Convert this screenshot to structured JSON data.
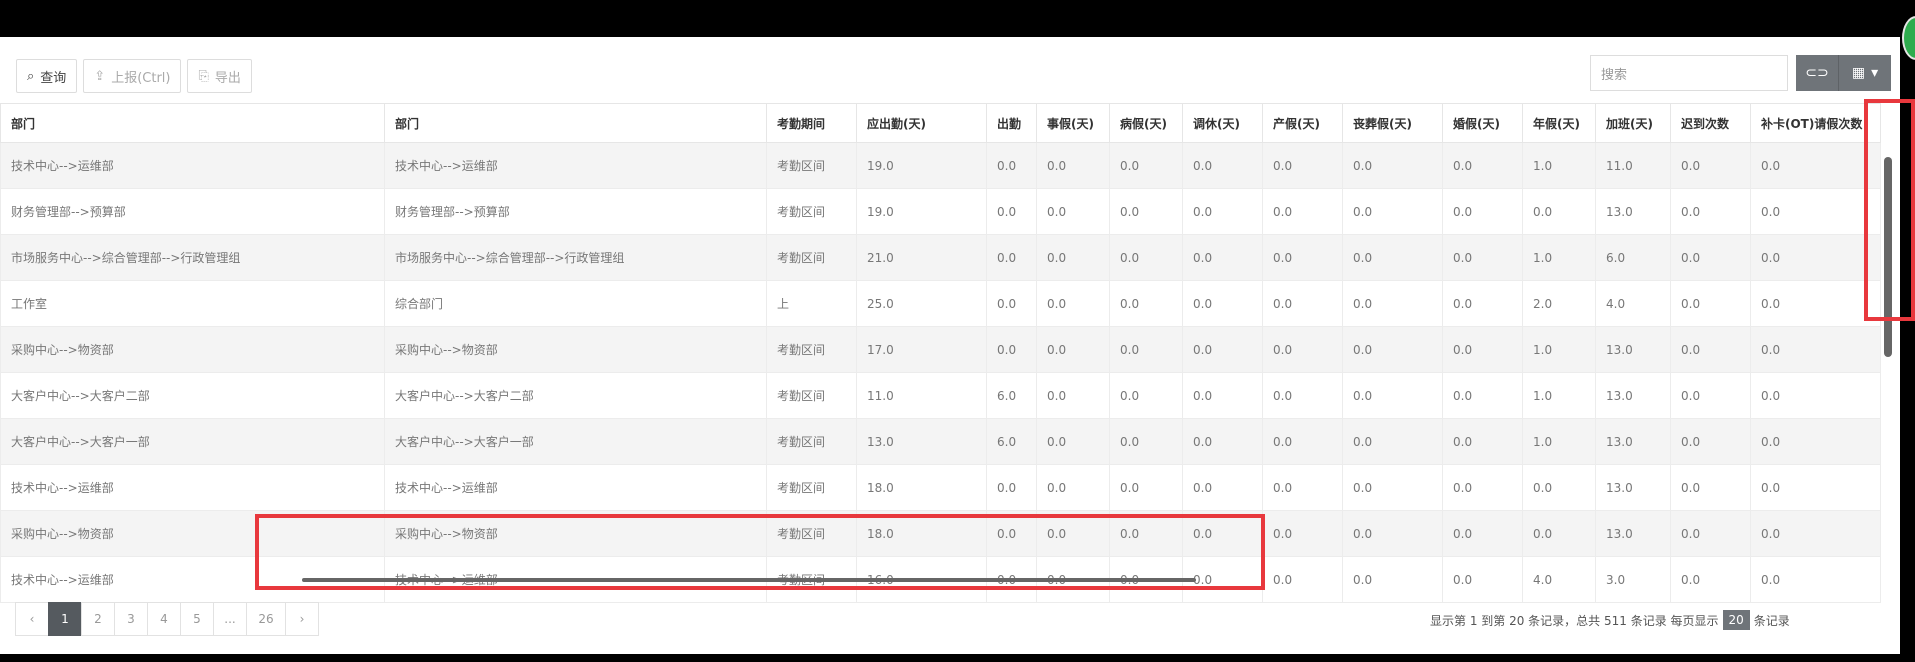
{
  "toolbar": {
    "buttons": [
      {
        "label": "查询",
        "icon": "search-icon"
      },
      {
        "label": "上报(Ctrl)",
        "icon": "upload-icon"
      },
      {
        "label": "导出",
        "icon": "export-icon"
      }
    ]
  },
  "search": {
    "placeholder": "搜索"
  },
  "table": {
    "headers": [
      "部门",
      "部门",
      "考勤期间",
      "应出勤(天)",
      "出勤",
      "事假(天)",
      "病假(天)",
      "调休(天)",
      "产假(天)",
      "丧葬假(天)",
      "婚假(天)",
      "年假(天)",
      "加班(天)",
      "迟到次数",
      "补卡(OT)请假次数"
    ],
    "rows": [
      [
        "技术中心-->运维部",
        "技术中心-->运维部",
        "考勤区间",
        "19.0",
        "0.0",
        "0.0",
        "0.0",
        "0.0",
        "0.0",
        "0.0",
        "0.0",
        "1.0",
        "11.0",
        "0.0",
        "0.0"
      ],
      [
        "财务管理部-->预算部",
        "财务管理部-->预算部",
        "考勤区间",
        "19.0",
        "0.0",
        "0.0",
        "0.0",
        "0.0",
        "0.0",
        "0.0",
        "0.0",
        "0.0",
        "13.0",
        "0.0",
        "0.0"
      ],
      [
        "市场服务中心-->综合管理部-->行政管理组",
        "市场服务中心-->综合管理部-->行政管理组",
        "考勤区间",
        "21.0",
        "0.0",
        "0.0",
        "0.0",
        "0.0",
        "0.0",
        "0.0",
        "0.0",
        "1.0",
        "6.0",
        "0.0",
        "0.0"
      ],
      [
        "工作室",
        "综合部门",
        "上",
        "25.0",
        "0.0",
        "0.0",
        "0.0",
        "0.0",
        "0.0",
        "0.0",
        "0.0",
        "2.0",
        "4.0",
        "0.0",
        "0.0"
      ],
      [
        "采购中心-->物资部",
        "采购中心-->物资部",
        "考勤区间",
        "17.0",
        "0.0",
        "0.0",
        "0.0",
        "0.0",
        "0.0",
        "0.0",
        "0.0",
        "1.0",
        "13.0",
        "0.0",
        "0.0"
      ],
      [
        "大客户中心-->大客户二部",
        "大客户中心-->大客户二部",
        "考勤区间",
        "11.0",
        "6.0",
        "0.0",
        "0.0",
        "0.0",
        "0.0",
        "0.0",
        "0.0",
        "1.0",
        "13.0",
        "0.0",
        "0.0"
      ],
      [
        "大客户中心-->大客户一部",
        "大客户中心-->大客户一部",
        "考勤区间",
        "13.0",
        "6.0",
        "0.0",
        "0.0",
        "0.0",
        "0.0",
        "0.0",
        "0.0",
        "1.0",
        "13.0",
        "0.0",
        "0.0"
      ],
      [
        "技术中心-->运维部",
        "技术中心-->运维部",
        "考勤区间",
        "18.0",
        "0.0",
        "0.0",
        "0.0",
        "0.0",
        "0.0",
        "0.0",
        "0.0",
        "0.0",
        "13.0",
        "0.0",
        "0.0"
      ],
      [
        "采购中心-->物资部",
        "采购中心-->物资部",
        "考勤区间",
        "18.0",
        "0.0",
        "0.0",
        "0.0",
        "0.0",
        "0.0",
        "0.0",
        "0.0",
        "0.0",
        "13.0",
        "0.0",
        "0.0"
      ],
      [
        "技术中心-->运维部",
        "技术中心-->运维部",
        "考勤区间",
        "16.0",
        "0.0",
        "0.0",
        "0.0",
        "0.0",
        "0.0",
        "0.0",
        "0.0",
        "4.0",
        "3.0",
        "0.0",
        "0.0"
      ]
    ]
  },
  "pagination": {
    "prev": "‹",
    "pages": [
      "1",
      "2",
      "3",
      "4",
      "5",
      "...",
      "26",
      "›"
    ],
    "active": "1",
    "info_text": "显示第 1 到第 20 条记录，总共 511 条记录 每页显示",
    "page_size": "20",
    "info_suffix": "条记录"
  },
  "colors": {
    "accent": "#6f7479",
    "highlight": "#e8383d",
    "badge": "#2eac4e"
  }
}
